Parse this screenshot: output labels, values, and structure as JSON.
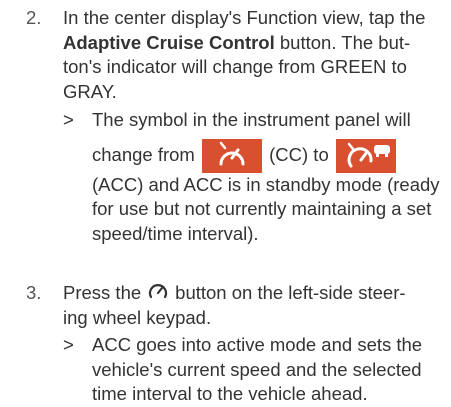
{
  "step2": {
    "number": "2.",
    "text_a": "In the center display's Function view, tap the ",
    "bold": "Adaptive Cruise Control",
    "text_b": " button. The button's indicator will change from GREEN to GRAY.",
    "line1": "In the center display's Function view, tap the",
    "line2_bold": "Adaptive Cruise Control",
    "line2_rest": " button. The but-",
    "line3": "ton's indicator will change from GREEN to",
    "line4": "GRAY.",
    "sub_arrow": ">",
    "sub_line1": "The symbol in the instrument panel will",
    "sub_change_from": "change from",
    "sub_cc": "(CC) to",
    "sub_line3": "(ACC) and ACC is in standby mode (ready",
    "sub_line4": "for use but not currently maintaining a set",
    "sub_line5": "speed/time interval).",
    "icon_cc": "cruise-control-speedometer-icon",
    "icon_acc": "adaptive-cruise-control-speedometer-car-icon",
    "badge_color": "#d8502f"
  },
  "step3": {
    "number": "3.",
    "line1a": "Press the",
    "line1b": "button on the left-side steer-",
    "line2": "ing wheel keypad.",
    "icon": "speedometer-button-icon",
    "sub_arrow": ">",
    "sub_line1": "ACC goes into active mode and sets the",
    "sub_line2": "vehicle's current speed and the selected",
    "sub_line3": "time interval to the vehicle ahead."
  }
}
